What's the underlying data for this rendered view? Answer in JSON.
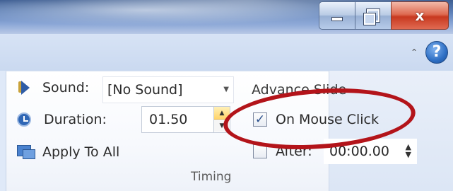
{
  "window": {
    "minimize_icon": "minimize-icon",
    "restore_icon": "restore-icon",
    "close_label": "x"
  },
  "ribbon": {
    "collapse_icon": "chevron-up-icon",
    "help_label": "?"
  },
  "timing": {
    "sound_label": "Sound:",
    "sound_value": "[No Sound]",
    "duration_label": "Duration:",
    "duration_value": "01.50",
    "apply_label": "Apply To All",
    "advance_label": "Advance Slide",
    "on_mouse_click_label": "On Mouse Click",
    "on_mouse_click_checked": true,
    "after_label": "After:",
    "after_checked": false,
    "after_value": "00:00.00",
    "group_label": "Timing"
  },
  "colors": {
    "highlight_ellipse": "#b3141a",
    "accent": "#2e6fc4"
  }
}
